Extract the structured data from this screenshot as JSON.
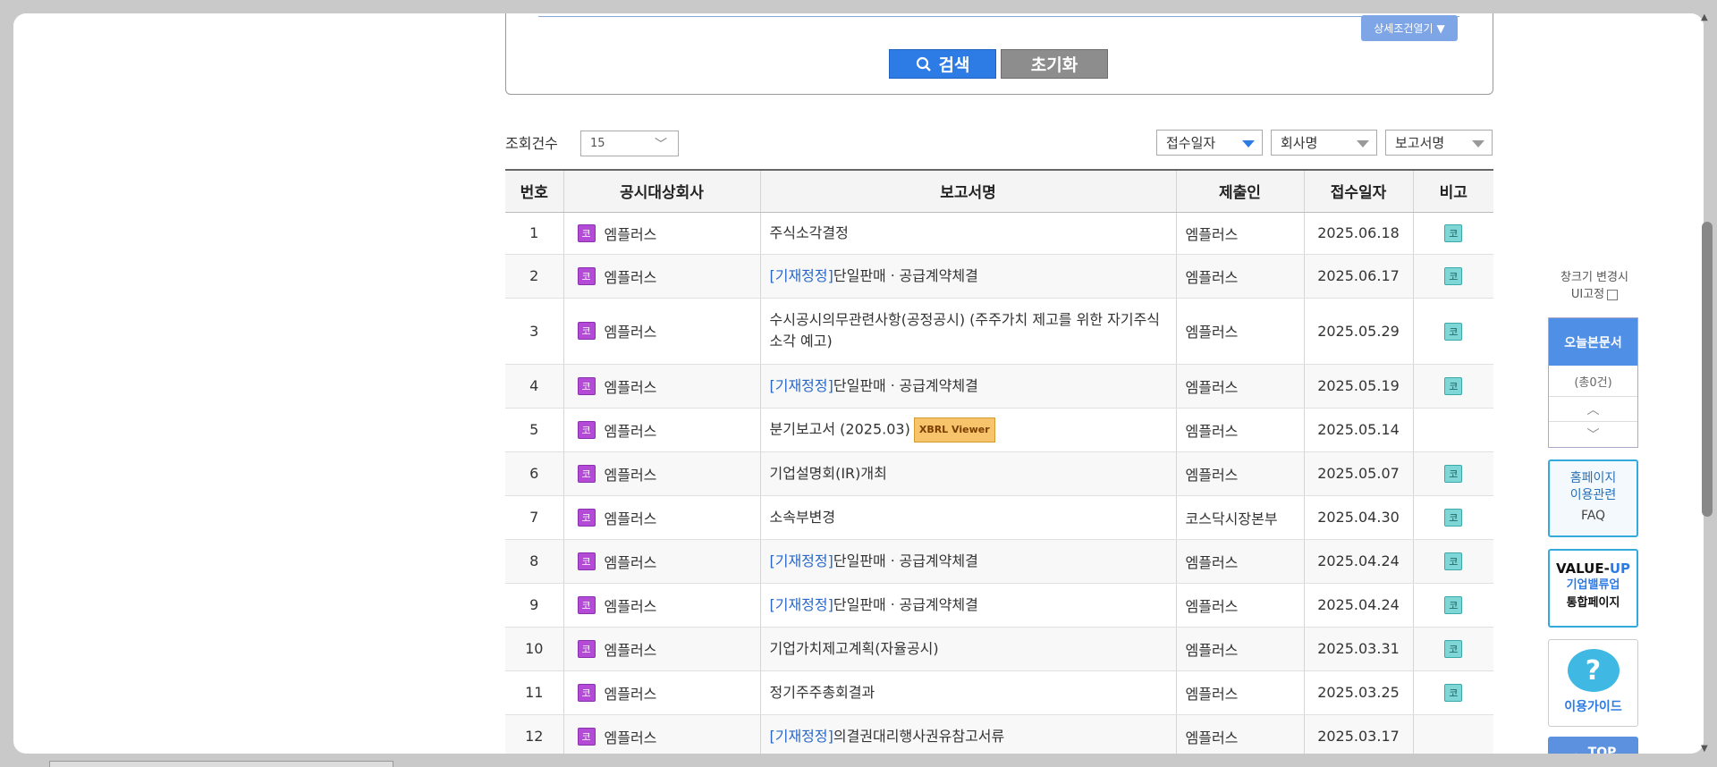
{
  "search": {
    "detail_label": "상세조건열기",
    "search_label": "검색",
    "reset_label": "초기화"
  },
  "controls": {
    "count_label": "조회건수",
    "count_value": "15",
    "sort_date": "접수일자",
    "sort_company": "회사명",
    "sort_report": "보고서명"
  },
  "table": {
    "headers": [
      "번호",
      "공시대상회사",
      "보고서명",
      "제출인",
      "접수일자",
      "비고"
    ],
    "market_badge": "코",
    "rows": [
      {
        "no": "1",
        "company": "엠플러스",
        "prefix": "",
        "report": "주식소각결정",
        "xbrl": "",
        "submitter": "엠플러스",
        "date": "2025.06.18",
        "note": "코"
      },
      {
        "no": "2",
        "company": "엠플러스",
        "prefix": "[기재정정]",
        "report": "단일판매ㆍ공급계약체결",
        "xbrl": "",
        "submitter": "엠플러스",
        "date": "2025.06.17",
        "note": "코"
      },
      {
        "no": "3",
        "company": "엠플러스",
        "prefix": "",
        "report": "수시공시의무관련사항(공정공시) (주주가치 제고를 위한 자기주식 소각 예고)",
        "xbrl": "",
        "submitter": "엠플러스",
        "date": "2025.05.29",
        "note": "코"
      },
      {
        "no": "4",
        "company": "엠플러스",
        "prefix": "[기재정정]",
        "report": "단일판매ㆍ공급계약체결",
        "xbrl": "",
        "submitter": "엠플러스",
        "date": "2025.05.19",
        "note": "코"
      },
      {
        "no": "5",
        "company": "엠플러스",
        "prefix": "",
        "report": "분기보고서 (2025.03)",
        "xbrl": "XBRL Viewer",
        "submitter": "엠플러스",
        "date": "2025.05.14",
        "note": ""
      },
      {
        "no": "6",
        "company": "엠플러스",
        "prefix": "",
        "report": "기업설명회(IR)개최",
        "xbrl": "",
        "submitter": "엠플러스",
        "date": "2025.05.07",
        "note": "코"
      },
      {
        "no": "7",
        "company": "엠플러스",
        "prefix": "",
        "report": "소속부변경",
        "xbrl": "",
        "submitter": "코스닥시장본부",
        "date": "2025.04.30",
        "note": "코"
      },
      {
        "no": "8",
        "company": "엠플러스",
        "prefix": "[기재정정]",
        "report": "단일판매ㆍ공급계약체결",
        "xbrl": "",
        "submitter": "엠플러스",
        "date": "2025.04.24",
        "note": "코"
      },
      {
        "no": "9",
        "company": "엠플러스",
        "prefix": "[기재정정]",
        "report": "단일판매ㆍ공급계약체결",
        "xbrl": "",
        "submitter": "엠플러스",
        "date": "2025.04.24",
        "note": "코"
      },
      {
        "no": "10",
        "company": "엠플러스",
        "prefix": "",
        "report": "기업가치제고계획(자율공시)",
        "xbrl": "",
        "submitter": "엠플러스",
        "date": "2025.03.31",
        "note": "코"
      },
      {
        "no": "11",
        "company": "엠플러스",
        "prefix": "",
        "report": "정기주주총회결과",
        "xbrl": "",
        "submitter": "엠플러스",
        "date": "2025.03.25",
        "note": "코"
      },
      {
        "no": "12",
        "company": "엠플러스",
        "prefix": "[기재정정]",
        "report": "의결권대리행사권유참고서류",
        "xbrl": "",
        "submitter": "엠플러스",
        "date": "2025.03.17",
        "note": ""
      }
    ]
  },
  "sidebar": {
    "resize_note_line1": "창크기 변경시",
    "resize_note_line2": "UI고정",
    "today_title": "오늘본문서",
    "today_count": "(총0건)",
    "faq_line1": "홈페이지",
    "faq_line2": "이용관련",
    "faq_line3": "FAQ",
    "valueup_prefix": "VALUE-",
    "valueup_suffix": "UP",
    "valueup_line2": "기업밸류업",
    "valueup_line3": "통합페이지",
    "guide_label": "이용가이드",
    "top_label": "TOP"
  }
}
